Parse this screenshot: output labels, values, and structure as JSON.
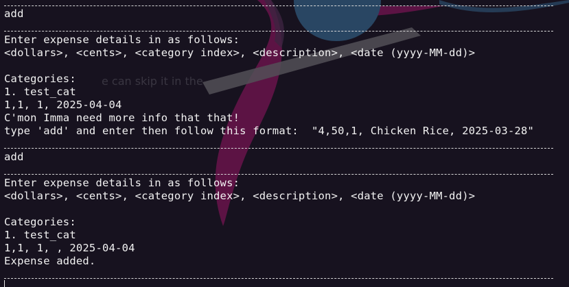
{
  "background": {
    "accent_pink": "#c0167a",
    "accent_blue": "#3f86b6",
    "accent_gray": "#9a9a9a"
  },
  "terminal": {
    "ghost_text": "e can skip it in the",
    "lines": [
      "add",
      "Enter expense details in as follows:",
      "<dollars>, <cents>, <category index>, <description>, <date (yyyy-MM-dd)>",
      "Categories:",
      "1. test_cat",
      "1,1, 1, 2025-04-04",
      "C'mon Imma need more info that that!",
      "type 'add' and enter then follow this format:  \"4,50,1, Chicken Rice, 2025-03-28\"",
      "add",
      "Enter expense details in as follows:",
      "<dollars>, <cents>, <category index>, <description>, <date (yyyy-MM-dd)>",
      "Categories:",
      "1. test_cat",
      "1,1, 1, , 2025-04-04",
      "Expense added."
    ]
  }
}
